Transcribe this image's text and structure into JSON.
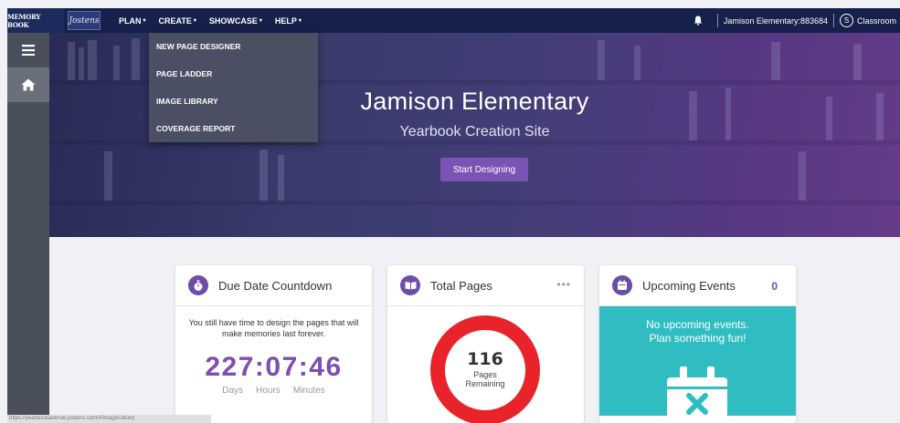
{
  "brand": {
    "logo": "MEMORY BOOK",
    "sublogo": "Jostens"
  },
  "nav": [
    {
      "label": "PLAN",
      "caret": "▾"
    },
    {
      "label": "CREATE",
      "caret": "▾"
    },
    {
      "label": "SHOWCASE",
      "caret": "▾"
    },
    {
      "label": "HELP",
      "caret": "▾"
    }
  ],
  "user": {
    "account": "Jamison Elementary:883684",
    "badge": "S",
    "mode": "Classroom"
  },
  "dropdown": [
    {
      "label": "NEW PAGE DESIGNER"
    },
    {
      "label": "PAGE LADDER"
    },
    {
      "label": "IMAGE LIBRARY"
    },
    {
      "label": "COVERAGE REPORT"
    }
  ],
  "hero": {
    "title": "Jamison Elementary",
    "subtitle": "Yearbook Creation Site",
    "button": "Start Designing"
  },
  "cards": {
    "countdown": {
      "title": "Due Date Countdown",
      "text": "You still have time to design the pages that will make memories last forever.",
      "value": "227:07:46",
      "units": [
        "Days",
        "Hours",
        "Minutes"
      ]
    },
    "pages": {
      "title": "Total Pages",
      "menu": "•••",
      "value": "116",
      "label1": "Pages",
      "label2": "Remaining",
      "remaining_fraction": 1.0
    },
    "events": {
      "title": "Upcoming Events",
      "count": "0",
      "line1": "No upcoming events.",
      "line2": "Plan something fun!"
    }
  },
  "statusbar": {
    "url": "https://yearbookavenue.jostens.com/#/imageLibrary"
  },
  "colors": {
    "nav": "#15204b",
    "accent": "#6d4da8",
    "ring": "#e8232a",
    "events": "#2fbdc1"
  }
}
